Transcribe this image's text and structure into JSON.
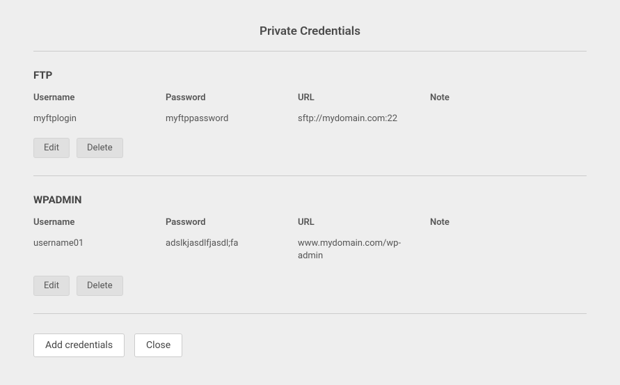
{
  "title": "Private Credentials",
  "columns": {
    "username": "Username",
    "password": "Password",
    "url": "URL",
    "note": "Note"
  },
  "buttons": {
    "edit": "Edit",
    "delete": "Delete",
    "add": "Add credentials",
    "close": "Close"
  },
  "sections": [
    {
      "name": "FTP",
      "username": "myftplogin",
      "password": "myftppassword",
      "url": "sftp://mydomain.com:22",
      "note": ""
    },
    {
      "name": "WPADMIN",
      "username": "username01",
      "password": "adslkjasdlfjasdl;fa",
      "url": "www.mydomain.com/wp-admin",
      "note": ""
    }
  ]
}
